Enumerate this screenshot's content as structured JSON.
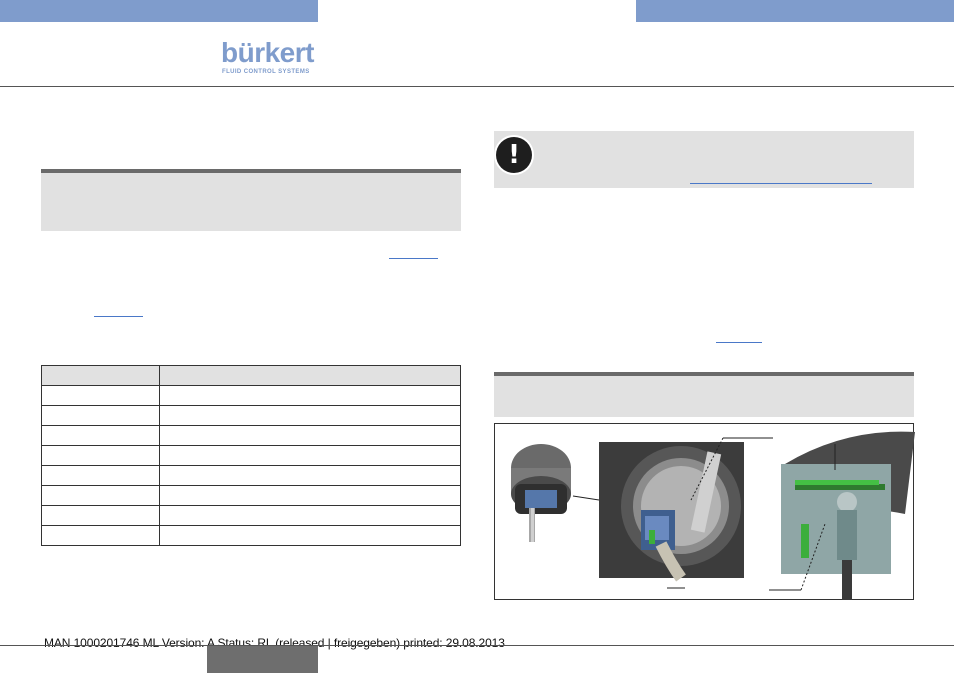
{
  "header": {
    "brand": "bürkert",
    "tagline": "FLUID CONTROL SYSTEMS"
  },
  "colors": {
    "brand_blue": "#7f9ccc",
    "section_gray": "#e1e1e1",
    "link_blue": "#4a78c8"
  },
  "note": {
    "icon": "exclamation-icon"
  },
  "footer": {
    "document_info": "MAN  1000201746  ML  Version: A Status: RL (released | freigegeben)  printed: 29.08.2013"
  }
}
